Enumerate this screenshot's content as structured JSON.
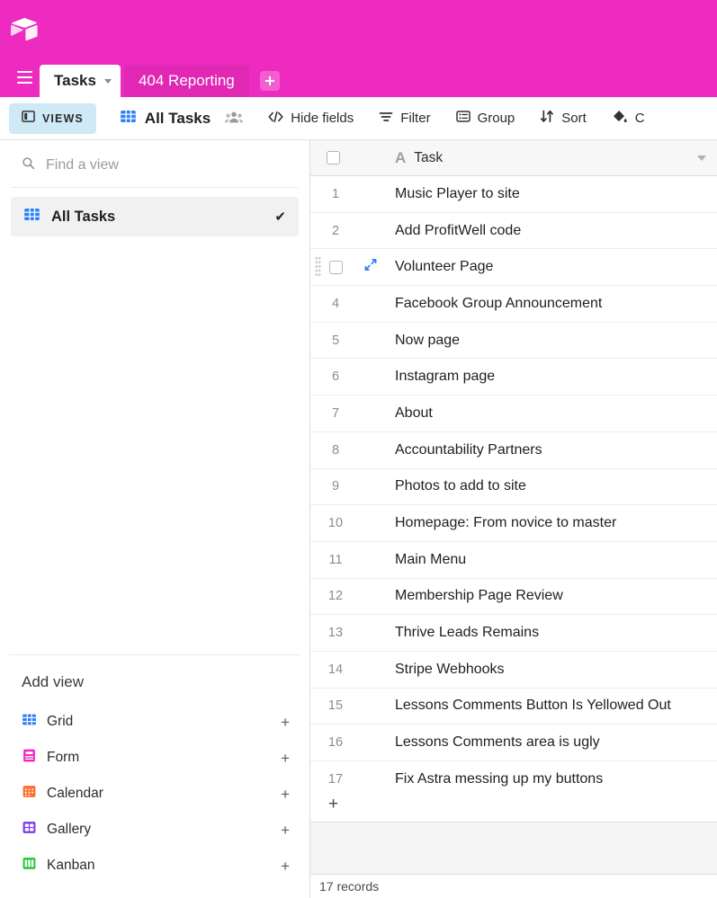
{
  "theme": {
    "brand_pink": "#ed2bc0",
    "tab_inactive_pink": "#e028b4",
    "views_blue": "#cfe9f7",
    "grid_blue": "#2d7ff9"
  },
  "topbar": {
    "logo_name": "airtable-logo"
  },
  "tabs": {
    "menu_icon": "hamburger-icon",
    "items": [
      {
        "label": "Tasks",
        "active": true
      },
      {
        "label": "404 Reporting",
        "active": false
      }
    ],
    "add_label": "+"
  },
  "toolbar": {
    "views_label": "VIEWS",
    "table_name": "All Tasks",
    "collaborators_icon": "people-icon",
    "buttons": [
      {
        "label": "Hide fields",
        "icon": "code-brackets-icon"
      },
      {
        "label": "Filter",
        "icon": "filter-icon"
      },
      {
        "label": "Group",
        "icon": "group-icon"
      },
      {
        "label": "Sort",
        "icon": "sort-arrows-icon"
      },
      {
        "label": "C",
        "icon": "paint-bucket-icon"
      }
    ]
  },
  "sidebar": {
    "search_placeholder": "Find a view",
    "search_value": "",
    "views": [
      {
        "label": "All Tasks",
        "icon": "grid-view-icon",
        "selected": true,
        "check": "✔"
      }
    ],
    "add_view_title": "Add view",
    "add_view_types": [
      {
        "label": "Grid",
        "icon": "grid-view-icon",
        "color": "#2d7ff9",
        "plus": "+"
      },
      {
        "label": "Form",
        "icon": "form-view-icon",
        "color": "#ed2bc0",
        "plus": "+"
      },
      {
        "label": "Calendar",
        "icon": "calendar-view-icon",
        "color": "#ff6f2c",
        "plus": "+"
      },
      {
        "label": "Gallery",
        "icon": "gallery-view-icon",
        "color": "#7c39ed",
        "plus": "+"
      },
      {
        "label": "Kanban",
        "icon": "kanban-view-icon",
        "color": "#20c933",
        "plus": "+"
      }
    ]
  },
  "grid": {
    "column": {
      "label": "Task",
      "type_icon": "text-field-icon",
      "type_glyph": "A"
    },
    "select_all_checkbox": false,
    "rows": [
      {
        "num": "1",
        "title": "Music Player to site"
      },
      {
        "num": "2",
        "title": "Add ProfitWell code"
      },
      {
        "num": "3",
        "title": "Volunteer Page",
        "hovered": true
      },
      {
        "num": "4",
        "title": "Facebook Group Announcement"
      },
      {
        "num": "5",
        "title": "Now page"
      },
      {
        "num": "6",
        "title": "Instagram page"
      },
      {
        "num": "7",
        "title": "About"
      },
      {
        "num": "8",
        "title": "Accountability Partners"
      },
      {
        "num": "9",
        "title": "Photos to add to site"
      },
      {
        "num": "10",
        "title": "Homepage: From novice to master"
      },
      {
        "num": "11",
        "title": "Main Menu"
      },
      {
        "num": "12",
        "title": "Membership Page Review"
      },
      {
        "num": "13",
        "title": "Thrive Leads Remains"
      },
      {
        "num": "14",
        "title": "Stripe Webhooks"
      },
      {
        "num": "15",
        "title": "Lessons Comments Button Is Yellowed Out"
      },
      {
        "num": "16",
        "title": "Lessons Comments area is ugly"
      },
      {
        "num": "17",
        "title": "Fix Astra messing up my buttons"
      }
    ],
    "add_row_label": "+",
    "record_count": "17 records"
  }
}
